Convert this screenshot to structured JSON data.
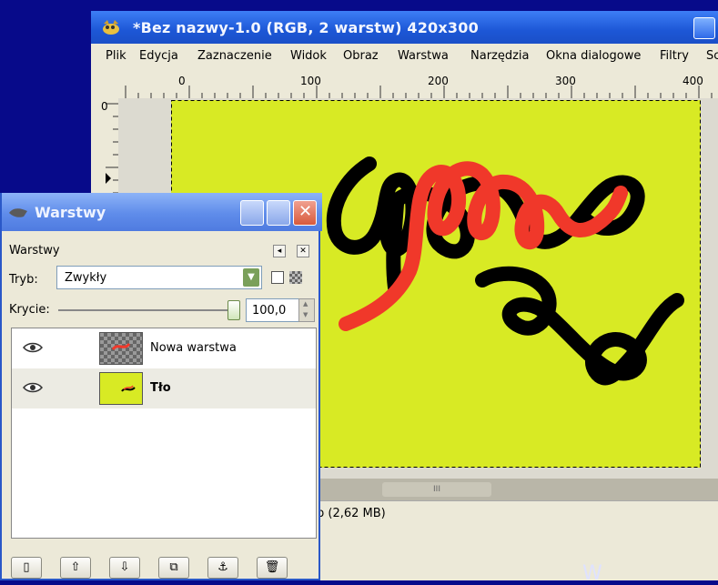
{
  "image_window": {
    "title": "*Bez nazwy-1.0 (RGB, 2 warstw) 420x300",
    "menu": [
      "Plik",
      "Edycja",
      "Zaznaczenie",
      "Widok",
      "Obraz",
      "Warstwa",
      "Narzędzia",
      "Okna dialogowe",
      "Filtry",
      "Sc"
    ],
    "ruler_top_labels": [
      "0",
      "100",
      "200",
      "300",
      "400"
    ],
    "ruler_left_labels": [
      "0"
    ],
    "status_text": "b (2,62 MB)",
    "scroll_grip": "III"
  },
  "layers_dialog": {
    "title": "Warstwy",
    "header_label": "Warstwy",
    "mode_label": "Tryb:",
    "mode_value": "Zwykły",
    "opacity_label": "Krycie:",
    "opacity_value": "100,0",
    "opacity_fraction": 1.0,
    "layers": [
      {
        "name": "Nowa warstwa",
        "visible": true,
        "bold": false
      },
      {
        "name": "Tło",
        "visible": true,
        "bold": true
      }
    ],
    "bottom_buttons": [
      "new-layer",
      "raise-layer",
      "lower-layer",
      "duplicate-layer",
      "anchor-layer",
      "delete-layer"
    ]
  },
  "corner_text": "W",
  "colors": {
    "desktop": "#070a8a",
    "canvas_background": "#d8ea24",
    "stroke_red": "#f0382a",
    "stroke_black": "#000000"
  }
}
